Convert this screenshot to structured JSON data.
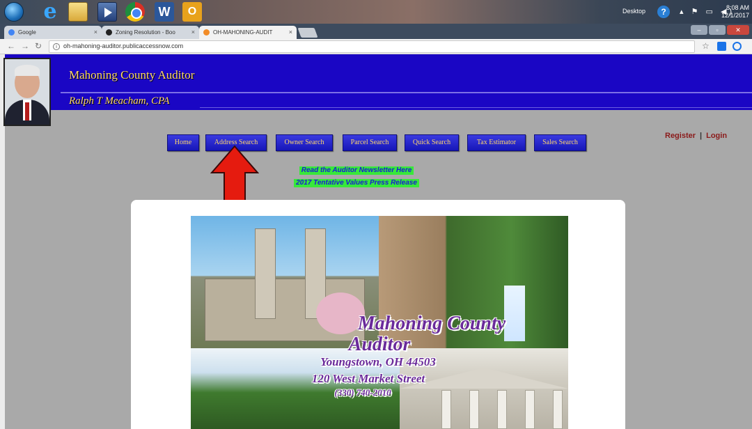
{
  "taskbar": {
    "tray_desktop_label": "Desktop",
    "time": "8:08 AM",
    "date": "12/1/2017"
  },
  "browser": {
    "tabs": [
      {
        "label": "Google",
        "active": false,
        "icon_color": "#4285f4"
      },
      {
        "label": "Zoning Resolution - Boo",
        "active": false,
        "icon_color": "#222222"
      },
      {
        "label": "OH-MAHONING-AUDIT",
        "active": true,
        "icon_color": "#f28c28"
      }
    ],
    "address_bar": {
      "url": "oh-mahoning-auditor.publicaccessnow.com"
    }
  },
  "site": {
    "banner": {
      "title": "Mahoning County Auditor",
      "subtitle": "Ralph T Meacham, CPA"
    },
    "nav": [
      {
        "label": "Home"
      },
      {
        "label": "Address Search"
      },
      {
        "label": "Owner Search"
      },
      {
        "label": "Parcel Search"
      },
      {
        "label": "Quick Search"
      },
      {
        "label": "Tax Estimator"
      },
      {
        "label": "Sales Search"
      }
    ],
    "auth": {
      "register": "Register",
      "separator": "|",
      "login": "Login"
    },
    "links": {
      "newsletter": "Read the Auditor Newsletter Here",
      "press_release": "2017 Tentative Values Press Release"
    },
    "hero": {
      "title_line1": "Mahoning County",
      "title_line2": "Auditor",
      "city": "Youngstown, OH 44503",
      "street": "120 West Market Street",
      "phone": "(330) 740-2010"
    }
  },
  "colors": {
    "banner_bg": "#1a06c4",
    "banner_text": "#ffd86a",
    "nav_button_bg": "#2626cc",
    "link_highlight": "#38e83a",
    "auth_text": "#8b1a1a",
    "arrow": "#e51b0f"
  }
}
